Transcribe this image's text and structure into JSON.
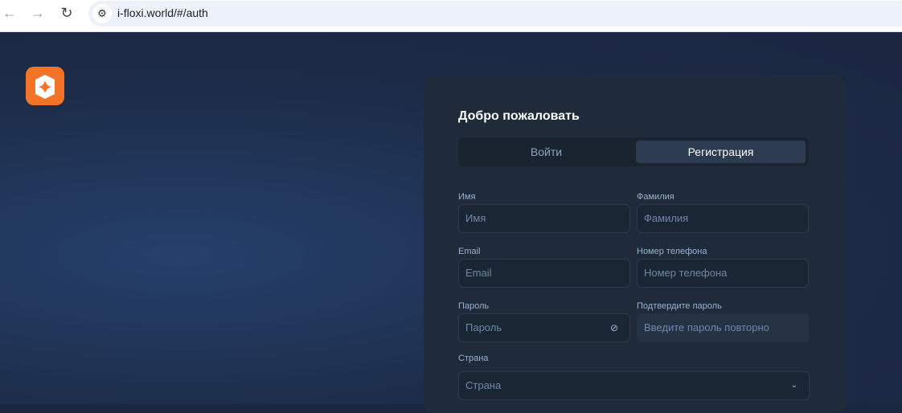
{
  "browser": {
    "url": "i-floxi.world/#/auth"
  },
  "card": {
    "title": "Добро пожаловать",
    "tabs": [
      "Войти",
      "Регистрация"
    ],
    "fields": {
      "first_name": {
        "label": "Имя",
        "placeholder": "Имя"
      },
      "last_name": {
        "label": "Фамилия",
        "placeholder": "Фамилия"
      },
      "email": {
        "label": "Email",
        "placeholder": "Email"
      },
      "phone": {
        "label": "Номер телефона",
        "placeholder": "Номер телефона"
      },
      "password": {
        "label": "Пароль",
        "placeholder": "Пароль"
      },
      "confirm": {
        "label": "Подтвердите пароль",
        "placeholder": "Введите пароль повторно"
      },
      "country": {
        "label": "Страна",
        "placeholder": "Страна"
      }
    }
  },
  "colors": {
    "accent": "#f47427"
  }
}
